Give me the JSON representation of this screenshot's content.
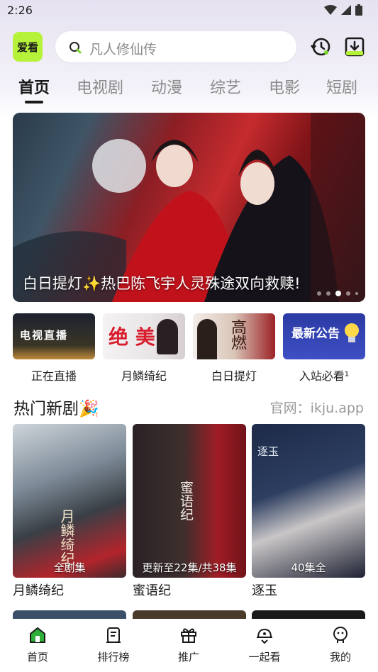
{
  "status": {
    "time": "2:26"
  },
  "logo": {
    "text": "爱看"
  },
  "search": {
    "placeholder": "凡人修仙传"
  },
  "tabs": [
    {
      "label": "首页",
      "active": true
    },
    {
      "label": "电视剧"
    },
    {
      "label": "动漫"
    },
    {
      "label": "综艺"
    },
    {
      "label": "电影"
    },
    {
      "label": "短剧"
    }
  ],
  "banner": {
    "caption": "白日提灯✨热巴陈飞宇人灵殊途双向救赎!",
    "dot_count": 5,
    "active_dot": 2
  },
  "shortcuts": [
    {
      "label": "正在直播",
      "thumb_text": "电视直播"
    },
    {
      "label": "月鳞绮纪",
      "thumb_text": "绝 美"
    },
    {
      "label": "白日提灯",
      "thumb_text": "高燃"
    },
    {
      "label": "入站必看¹",
      "thumb_text": "最新公告"
    }
  ],
  "section": {
    "title": "热门新剧🎉",
    "note": "官网：ikju.app"
  },
  "cards": [
    {
      "title": "月鳞绮纪",
      "badge": "全剧集",
      "poster_text": "月鳞绮纪"
    },
    {
      "title": "蜜语纪",
      "badge": "更新至22集/共38集",
      "poster_text": "蜜语纪"
    },
    {
      "title": "逐玉",
      "badge": "40集全",
      "poster_text": "逐玉"
    }
  ],
  "bottom_nav": [
    {
      "label": "首页",
      "icon": "home-icon",
      "active": true
    },
    {
      "label": "排行榜",
      "icon": "ranking-icon"
    },
    {
      "label": "推广",
      "icon": "gift-icon"
    },
    {
      "label": "一起看",
      "icon": "watch-together-icon"
    },
    {
      "label": "我的",
      "icon": "profile-icon"
    }
  ],
  "colors": {
    "accent": "#b7f23a",
    "active_nav": "#2fae3a"
  }
}
